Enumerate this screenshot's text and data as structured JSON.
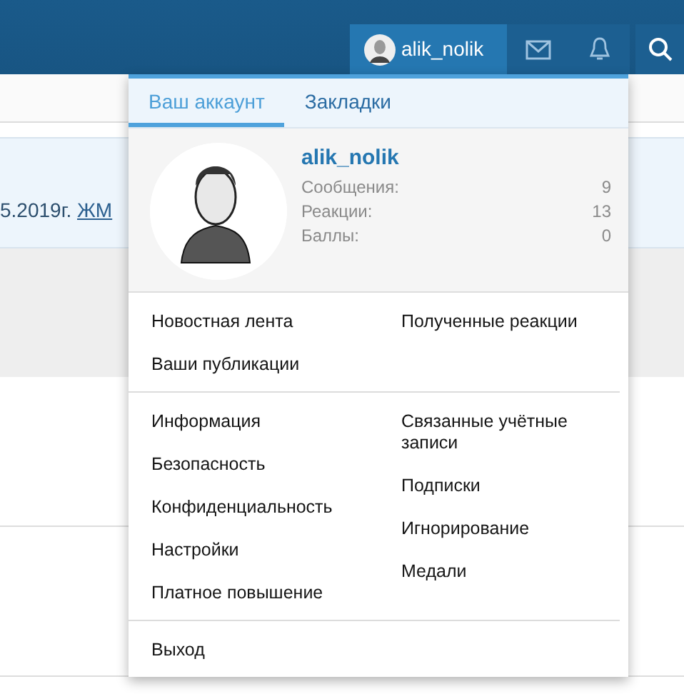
{
  "header": {
    "user": {
      "name": "alik_nolik",
      "selected": true
    }
  },
  "notice": {
    "text": "5.2019г.",
    "link": "ЖМ"
  },
  "menu": {
    "tabs": [
      {
        "label": "Ваш аккаунт",
        "selected": true
      },
      {
        "label": "Закладки",
        "selected": false
      }
    ],
    "profile": {
      "name": "alik_nolik",
      "stats": [
        {
          "label": "Сообщения:",
          "value": "9"
        },
        {
          "label": "Реакции:",
          "value": "13"
        },
        {
          "label": "Баллы:",
          "value": "0"
        }
      ]
    },
    "sections": [
      {
        "left": [
          "Новостная лента",
          "Ваши публикации"
        ],
        "right": [
          "Полученные реакции"
        ]
      },
      {
        "left": [
          "Информация",
          "Безопасность",
          "Конфиденциальность",
          "Настройки",
          "Платное повышение"
        ],
        "right": [
          "Связанные учётные записи",
          "Подписки",
          "Игнорирование",
          "Медали"
        ]
      },
      {
        "left": [
          "Выход"
        ]
      }
    ]
  }
}
